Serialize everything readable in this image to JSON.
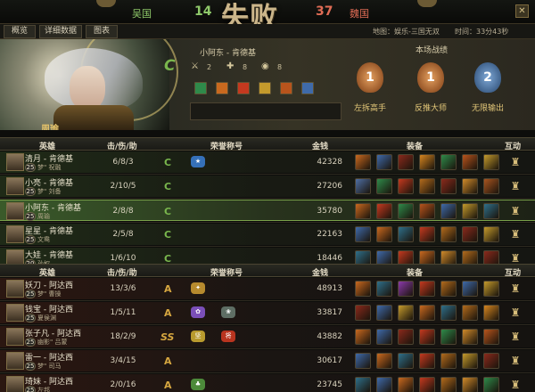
{
  "header": {
    "team_left": "吴国",
    "score_left": "14",
    "result": "失败",
    "score_right": "37",
    "team_right": "魏国",
    "close": "✕"
  },
  "tabs": [
    {
      "label": "概览"
    },
    {
      "label": "详细数据"
    },
    {
      "label": "图表"
    }
  ],
  "meta": {
    "map": "地图：娱乐-三国无双",
    "time": "时间：33分43秒"
  },
  "player_card": {
    "title": "小阿东 - 肯德基",
    "honor_letter": "C",
    "stats": {
      "kill_icon": "⚔",
      "kills": "2",
      "assist_icon": "✚",
      "assists": "8",
      "gold_icon": "◉",
      "gold_count": "8"
    },
    "hero": "周瑜"
  },
  "honors": {
    "header": "本场战绩",
    "medals": [
      {
        "num": "1",
        "label": "左拆高手",
        "color": "#b8692b"
      },
      {
        "num": "1",
        "label": "反推大师",
        "color": "#b8692b"
      },
      {
        "num": "2",
        "label": "无限输出",
        "color": "#3e6ea0"
      }
    ]
  },
  "table_headers": {
    "hero": "英雄",
    "kda": "击/伤/助",
    "honor": "荣誉称号",
    "gold": "金钱",
    "equip": "装备",
    "interact": "互动"
  },
  "team_green": [
    {
      "name": "清月 - 肯德基",
      "level": "25",
      "hero": "梦\" 祝融",
      "kda": "6/8/3",
      "honor": "C",
      "badges": [
        {
          "text": "★",
          "color": "#3570b8"
        }
      ],
      "gold": "42328",
      "items": [
        "#c9691f",
        "#3f6aa9",
        "#8a2a1c",
        "#d6851f",
        "#2f8a4a",
        "#b8541c",
        "#c49a2c"
      ]
    },
    {
      "name": "小亮 - 肯德基",
      "level": "25",
      "hero": "梦\" 刘备",
      "kda": "2/10/5",
      "honor": "C",
      "badges": [],
      "gold": "27206",
      "items": [
        "#4f6fa4",
        "#2f8a4a",
        "#c4391f",
        "#b36b1c",
        "#8a2a1c",
        "#d08a2a",
        "#a8541f"
      ]
    },
    {
      "name": "小阿东 - 肯德基",
      "level": "25",
      "hero": "周瑜",
      "kda": "2/8/8",
      "honor": "C",
      "badges": [],
      "gold": "35780",
      "items": [
        "#c9691f",
        "#c4391f",
        "#2f8a4a",
        "#b8541c",
        "#3f6aa9",
        "#c49a2c",
        "#2f6f8a"
      ],
      "selected": true
    },
    {
      "name": "星星 - 肯德基",
      "level": "25",
      "hero": "文鸯",
      "kda": "2/5/8",
      "honor": "C",
      "badges": [],
      "gold": "22163",
      "items": [
        "#3f6aa9",
        "#c9691f",
        "#2f6f8a",
        "#c4391f",
        "#b36b1c",
        "#8a2a1c",
        "#c49a2c"
      ]
    },
    {
      "name": "大娃 - 肯德基",
      "level": "20",
      "hero": "孙权",
      "kda": "1/6/10",
      "honor": "C",
      "badges": [],
      "gold": "18446",
      "items": [
        "#2f6f8a",
        "#3f6aa9",
        "#c4391f",
        "#c9691f",
        "#d08a2a",
        "#b36b1c",
        "#8a2a1c"
      ]
    }
  ],
  "team_red": [
    {
      "name": "妖刀 - 阿达西",
      "level": "25",
      "hero": "梦\" 曹操",
      "kda": "13/3/6",
      "honor": "A",
      "badges": [
        {
          "text": "✦",
          "color": "#b68a2e"
        }
      ],
      "gold": "48913",
      "items": [
        "#c9691f",
        "#2f6f8a",
        "#8a3aa9",
        "#c4391f",
        "#b36b1c",
        "#3f6aa9",
        "#c49a2c"
      ]
    },
    {
      "name": "钱宝 - 阿达西",
      "level": "25",
      "hero": "夏侯渊",
      "kda": "1/5/11",
      "honor": "A",
      "badges": [
        {
          "text": "✿",
          "color": "#7a4fb8"
        },
        {
          "text": "❀",
          "color": "#5e6e64"
        }
      ],
      "gold": "33817",
      "items": [
        "#8a2a1c",
        "#3f6aa9",
        "#c49a2c",
        "#c9691f",
        "#2f6f8a",
        "#b36b1c",
        "#d6851f"
      ]
    },
    {
      "name": "张子凡 - 阿达西",
      "level": "25",
      "hero": "幽影\" 吕蒙",
      "kda": "18/2/9",
      "honor": "SS",
      "badges": [
        {
          "text": "坚",
          "color": "#b89a2e"
        },
        {
          "text": "将",
          "color": "#b8341f"
        }
      ],
      "gold": "43882",
      "items": [
        "#c9691f",
        "#3f6aa9",
        "#8a2a1c",
        "#c4391f",
        "#2f8a4a",
        "#d08a2a",
        "#b8541c"
      ]
    },
    {
      "name": "雷一 - 阿达西",
      "level": "25",
      "hero": "梦\" 司马",
      "kda": "3/4/15",
      "honor": "A",
      "badges": [],
      "gold": "30617",
      "items": [
        "#3f6aa9",
        "#c9691f",
        "#2f6f8a",
        "#c4391f",
        "#b36b1c",
        "#c49a2c",
        "#8a2a1c"
      ]
    },
    {
      "name": "琦妹 - 阿达西",
      "level": "25",
      "hero": "左邦",
      "kda": "2/0/16",
      "honor": "A",
      "badges": [
        {
          "text": "♣",
          "color": "#4c8a3a"
        }
      ],
      "gold": "23745",
      "items": [
        "#2f6f8a",
        "#3f6aa9",
        "#c9691f",
        "#c4391f",
        "#b36b1c",
        "#d08a2a",
        "#2f8a4a"
      ]
    }
  ],
  "colors": {
    "green_team": "#8fc96a",
    "red_team": "#e16c55",
    "honor_c": "#79b64d",
    "honor_a": "#d5a640",
    "accent_gold": "#e1c06a"
  },
  "icons": {
    "trophy": "♜"
  }
}
